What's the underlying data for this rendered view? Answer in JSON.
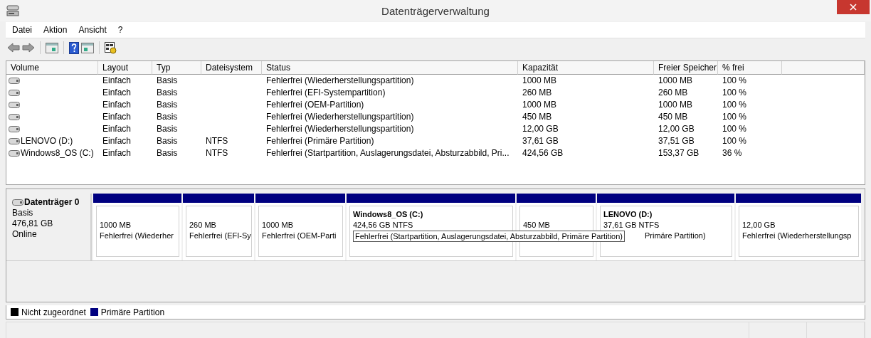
{
  "window": {
    "title": "Datenträgerverwaltung"
  },
  "menu": [
    "Datei",
    "Aktion",
    "Ansicht",
    "?"
  ],
  "toolbar": [
    {
      "kind": "back"
    },
    {
      "kind": "forward"
    },
    {
      "kind": "separator"
    },
    {
      "kind": "tree"
    },
    {
      "kind": "separator"
    },
    {
      "kind": "help"
    },
    {
      "kind": "pane"
    },
    {
      "kind": "separator"
    },
    {
      "kind": "properties"
    }
  ],
  "table": {
    "columns": [
      "Volume",
      "Layout",
      "Typ",
      "Dateisystem",
      "Status",
      "Kapazität",
      "Freier Speicher",
      "% frei"
    ],
    "rows": [
      {
        "cells": [
          "",
          "Einfach",
          "Basis",
          "",
          "Fehlerfrei (Wiederherstellungspartition)",
          "1000 MB",
          "1000 MB",
          "100 %"
        ]
      },
      {
        "cells": [
          "",
          "Einfach",
          "Basis",
          "",
          "Fehlerfrei (EFI-Systempartition)",
          "260 MB",
          "260 MB",
          "100 %"
        ]
      },
      {
        "cells": [
          "",
          "Einfach",
          "Basis",
          "",
          "Fehlerfrei (OEM-Partition)",
          "1000 MB",
          "1000 MB",
          "100 %"
        ]
      },
      {
        "cells": [
          "",
          "Einfach",
          "Basis",
          "",
          "Fehlerfrei (Wiederherstellungspartition)",
          "450 MB",
          "450 MB",
          "100 %"
        ]
      },
      {
        "cells": [
          "",
          "Einfach",
          "Basis",
          "",
          "Fehlerfrei (Wiederherstellungspartition)",
          "12,00 GB",
          "12,00 GB",
          "100 %"
        ]
      },
      {
        "cells": [
          "LENOVO (D:)",
          "Einfach",
          "Basis",
          "NTFS",
          "Fehlerfrei (Primäre Partition)",
          "37,61 GB",
          "37,51 GB",
          "100 %"
        ]
      },
      {
        "cells": [
          "Windows8_OS (C:)",
          "Einfach",
          "Basis",
          "NTFS",
          "Fehlerfrei (Startpartition, Auslagerungsdatei, Absturzabbild, Pri...",
          "424,56 GB",
          "153,37 GB",
          "36 %"
        ]
      }
    ]
  },
  "disk": {
    "name": "Datenträger 0",
    "type": "Basis",
    "size": "476,81 GB",
    "state": "Online",
    "partitions": [
      {
        "color": "#000080",
        "size": "1000 MB",
        "status": "Fehlerfrei (Wiederher"
      },
      {
        "color": "#000080",
        "size": "260 MB",
        "status": "Fehlerfrei (EFI-Sy"
      },
      {
        "color": "#000080",
        "size": "1000 MB",
        "status": "Fehlerfrei (OEM-Parti"
      },
      {
        "color": "#000080",
        "name": "Windows8_OS  (C:)",
        "size": "424,56 GB NTFS",
        "tooltip": "Fehlerfrei (Startpartition, Auslagerungsdatei, Absturzabbild, Primäre Partition)"
      },
      {
        "color": "#000080",
        "size": "450 MB"
      },
      {
        "color": "#000080",
        "name": "LENOVO  (D:)",
        "size": "37,61 GB NTFS",
        "status": "Primäre Partition)",
        "status_covered": true
      },
      {
        "color": "#000080",
        "size": "12,00 GB",
        "status": "Fehlerfrei (Wiederherstellungsp"
      }
    ]
  },
  "legend": [
    {
      "label": "Nicht zugeordnet",
      "color": "#000000"
    },
    {
      "label": "Primäre Partition",
      "color": "#000080"
    }
  ]
}
